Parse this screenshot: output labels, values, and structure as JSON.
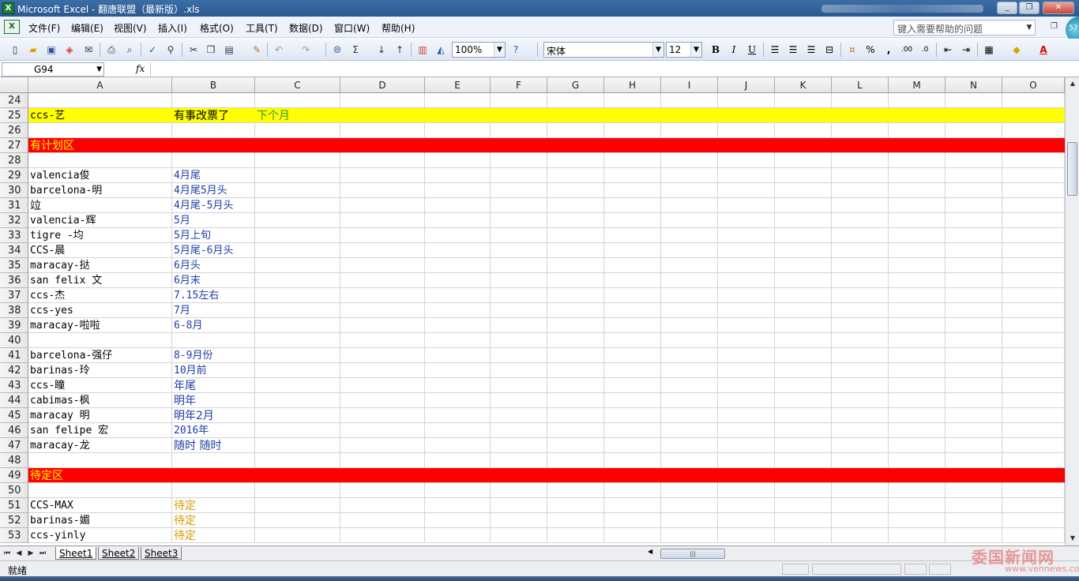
{
  "window": {
    "title": "Microsoft Excel - 翻唐联盟（最新版）.xls",
    "minimize": "_",
    "restore": "❐",
    "close": "✕"
  },
  "menu": {
    "items": [
      "文件(F)",
      "编辑(E)",
      "视图(V)",
      "插入(I)",
      "格式(O)",
      "工具(T)",
      "数据(D)",
      "窗口(W)",
      "帮助(H)"
    ],
    "help_placeholder": "键入需要帮助的问题",
    "corner_badge": "57"
  },
  "toolbar": {
    "zoom": "100%",
    "font_name": "宋体",
    "font_size": "12",
    "bold": "B",
    "italic": "I",
    "underline": "U",
    "sum_symbol": "Σ",
    "percent": "%",
    "comma": ",",
    "increase_decimal": ".00",
    "decrease_decimal": ".0",
    "font_color_symbol": "A"
  },
  "formula_bar": {
    "name_box": "G94",
    "fx": "fx",
    "value": ""
  },
  "columns": [
    "A",
    "B",
    "C",
    "D",
    "E",
    "F",
    "G",
    "H",
    "I",
    "J",
    "K",
    "L",
    "M",
    "N",
    "O"
  ],
  "colors": {
    "blue_text": "#1f3fa6",
    "orange_text": "#d99a00",
    "yellow_fill": "#ffff00",
    "red_fill": "#ff0000",
    "green_text": "#3a9a3a",
    "yellow_on_red": "#ffff00"
  },
  "rows": [
    {
      "num": "24",
      "a": "",
      "b": "",
      "c": ""
    },
    {
      "num": "25",
      "a": "ccs-艺",
      "b": "有事改票了",
      "c": "下个月",
      "fill": "yellow"
    },
    {
      "num": "26",
      "a": "",
      "b": "",
      "c": ""
    },
    {
      "num": "27",
      "a": "有计划区",
      "b": "",
      "c": "",
      "fill": "red"
    },
    {
      "num": "28",
      "a": "",
      "b": "",
      "c": ""
    },
    {
      "num": "29",
      "a": "valencia俊",
      "b": "4月尾",
      "c": ""
    },
    {
      "num": "30",
      "a": "barcelona-明",
      "b": "4月尾5月头",
      "c": ""
    },
    {
      "num": "31",
      "a": "竝",
      "b": "4月尾-5月头",
      "c": ""
    },
    {
      "num": "32",
      "a": "valencia-辉",
      "b": "5月",
      "c": ""
    },
    {
      "num": "33",
      "a": "tigre -均",
      "b": "5月上旬",
      "c": ""
    },
    {
      "num": "34",
      "a": "CCS-晨",
      "b": "5月尾-6月头",
      "c": ""
    },
    {
      "num": "35",
      "a": "maracay-挞",
      "b": "6月头",
      "c": ""
    },
    {
      "num": "36",
      "a": "san felix 文",
      "b": "6月末",
      "c": ""
    },
    {
      "num": "37",
      "a": "ccs-杰",
      "b": "7.15左右",
      "c": ""
    },
    {
      "num": "38",
      "a": "ccs-yes",
      "b": "7月",
      "c": ""
    },
    {
      "num": "39",
      "a": "maracay-啦啦",
      "b": "6-8月",
      "c": ""
    },
    {
      "num": "40",
      "a": "",
      "b": "",
      "c": ""
    },
    {
      "num": "41",
      "a": "barcelona-强仔",
      "b": "8-9月份",
      "c": ""
    },
    {
      "num": "42",
      "a": "barinas-玲",
      "b": "10月前",
      "c": ""
    },
    {
      "num": "43",
      "a": "ccs-瞳",
      "b": "年尾",
      "c": ""
    },
    {
      "num": "44",
      "a": "cabimas-枫",
      "b": "明年",
      "c": ""
    },
    {
      "num": "45",
      "a": "maracay 明",
      "b": "明年2月",
      "c": ""
    },
    {
      "num": "46",
      "a": "san felipe 宏",
      "b": "2016年",
      "c": ""
    },
    {
      "num": "47",
      "a": "maracay-龙",
      "b": "随时 随时",
      "c": ""
    },
    {
      "num": "48",
      "a": "",
      "b": "",
      "c": ""
    },
    {
      "num": "49",
      "a": "待定区",
      "b": "",
      "c": "",
      "fill": "red"
    },
    {
      "num": "50",
      "a": "",
      "b": "",
      "c": ""
    },
    {
      "num": "51",
      "a": "CCS-MAX",
      "b": "待定",
      "c": "",
      "bstyle": "orange"
    },
    {
      "num": "52",
      "a": "barinas-媚",
      "b": "待定",
      "c": "",
      "bstyle": "orange"
    },
    {
      "num": "53",
      "a": "ccs-yinly",
      "b": "待定",
      "c": "",
      "bstyle": "orange"
    }
  ],
  "sheets": [
    "Sheet1",
    "Sheet2",
    "Sheet3"
  ],
  "status": {
    "ready": "就绪"
  },
  "watermark": {
    "text": "委国新闻网",
    "url": "www.vennews.com"
  }
}
